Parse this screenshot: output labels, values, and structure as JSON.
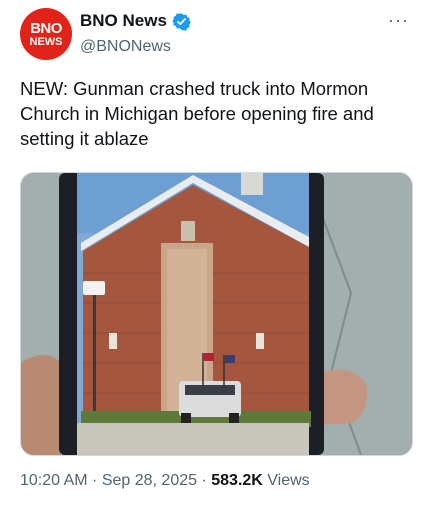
{
  "author": {
    "avatar_line1": "BNO",
    "avatar_line2": "NEWS",
    "display_name": "BNO News",
    "handle": "@BNONews"
  },
  "icons": {
    "verified": "verified-badge-icon",
    "more": "more-options-icon"
  },
  "more_label": "···",
  "tweet": {
    "text": "NEW: Gunman crashed truck into Mormon Church in Michigan before opening fire and setting it ablaze"
  },
  "meta": {
    "time": "10:20 AM",
    "sep1": " · ",
    "date": "Sep 28, 2025",
    "sep2": " · ",
    "views_count": "583.2K",
    "views_label": " Views"
  },
  "colors": {
    "brand_red": "#e2231a",
    "verified_blue": "#1d9bf0",
    "text_primary": "#0f1419",
    "text_secondary": "#536471"
  }
}
